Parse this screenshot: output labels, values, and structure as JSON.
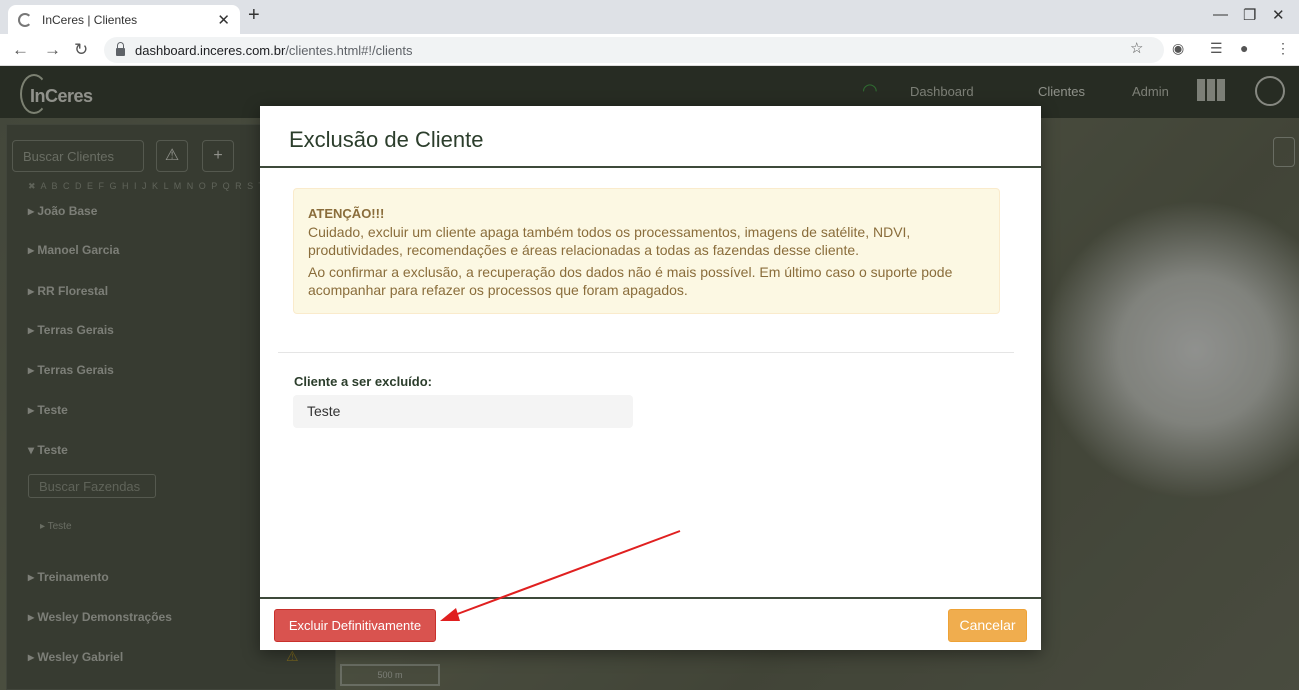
{
  "browser": {
    "tab_title": "InCeres | Clientes",
    "url_host": "dashboard.inceres.com.br",
    "url_path": "/clientes.html#!/clients"
  },
  "app": {
    "logo": "InCeres",
    "nav": [
      {
        "label": "Dashboard"
      },
      {
        "label": "Clientes"
      },
      {
        "label": "Admin"
      }
    ]
  },
  "sidebar": {
    "search_placeholder": "Buscar Clientes",
    "alphabet": "✖ A B C D E F G H I J K L M N O P Q R S T U V",
    "clients": [
      {
        "label": "▸ João Base"
      },
      {
        "label": "▸ Manoel Garcia"
      },
      {
        "label": "▸ RR Florestal"
      },
      {
        "label": "▸ Terras Gerais"
      },
      {
        "label": "▸ Terras Gerais"
      },
      {
        "label": "▸ Teste"
      },
      {
        "label": "▾ Teste"
      },
      {
        "label": "▸ Treinamento"
      },
      {
        "label": "▸ Wesley Demonstrações"
      },
      {
        "label": "▸ Wesley Gabriel"
      }
    ],
    "farm_search_placeholder": "Buscar Fazendas",
    "farm": "▸ Teste",
    "scale": "500 m"
  },
  "modal": {
    "title": "Exclusão de Cliente",
    "alert_title": "ATENÇÃO!!!",
    "alert_p1": "Cuidado, excluir um cliente apaga também todos os processamentos, imagens de satélite, NDVI, produtividades, recomendações e áreas relacionadas a todas as fazendas desse cliente.",
    "alert_p2": "Ao confirmar a exclusão, a recuperação dos dados não é mais possível. Em último caso o suporte pode acompanhar para refazer os processos que foram apagados.",
    "field_label": "Cliente a ser excluído:",
    "field_value": "Teste",
    "delete_button": "Excluir Definitivamente",
    "cancel_button": "Cancelar"
  },
  "colors": {
    "danger": "#d9534f",
    "warning": "#f0ad4e",
    "alert_bg": "#fcf8e3",
    "header_bg": "#404739"
  }
}
